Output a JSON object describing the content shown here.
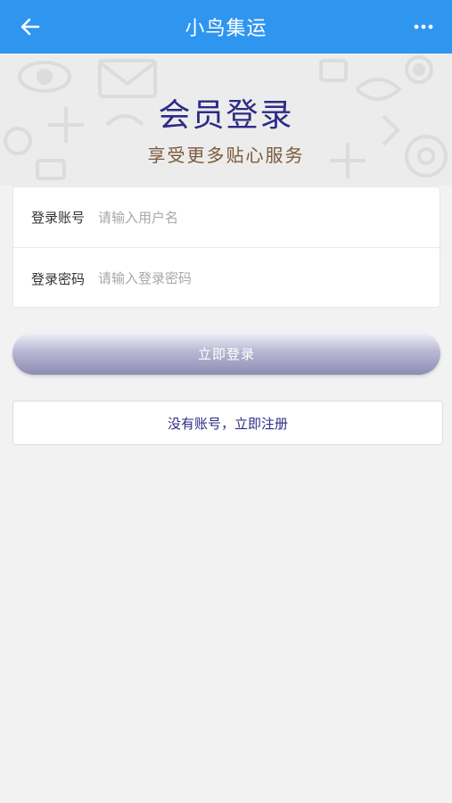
{
  "header": {
    "title": "小鸟集运",
    "back_icon": "arrow-left-icon",
    "more_icon": "more-dots-icon",
    "color": "#2f96f0"
  },
  "hero": {
    "heading": "会员登录",
    "subheading": "享受更多贴心服务"
  },
  "form": {
    "account_label": "登录账号",
    "account_placeholder": "请输入用户名",
    "account_value": "",
    "password_label": "登录密码",
    "password_placeholder": "请输入登录密码",
    "password_value": ""
  },
  "actions": {
    "login_label": "立即登录",
    "register_label": "没有账号，立即注册"
  },
  "colors": {
    "accent": "#2e2a86",
    "subtitle": "#7a5a3a",
    "page_bg": "#f2f2f2"
  }
}
